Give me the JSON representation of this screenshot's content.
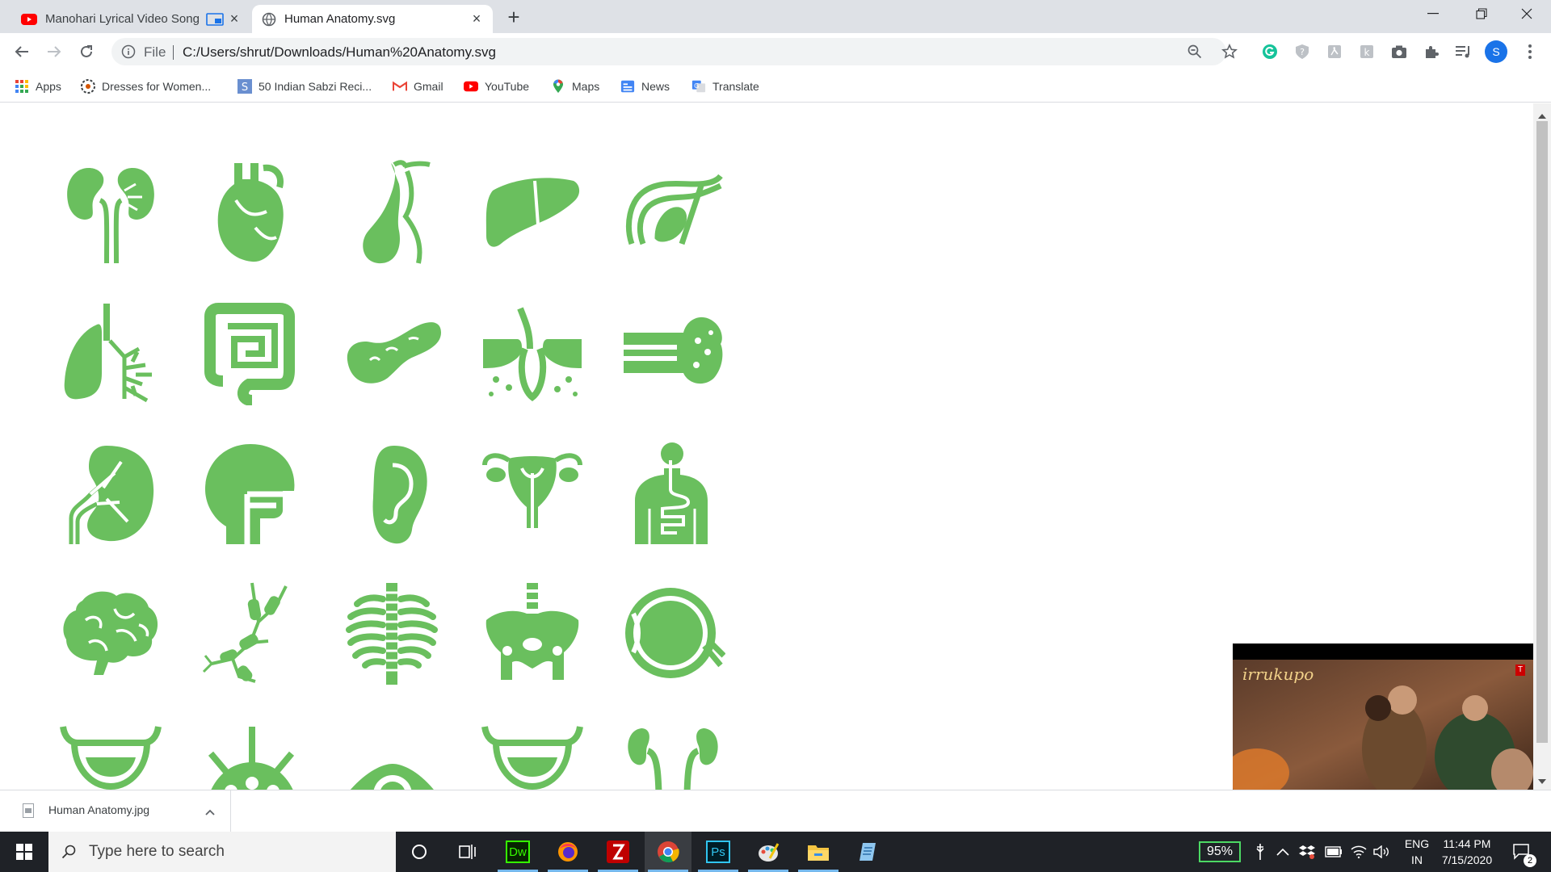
{
  "tabs": [
    {
      "title": "Manohari Lyrical Video Song",
      "icon": "youtube-icon",
      "extra_icon": "picture-in-picture-icon",
      "active": false
    },
    {
      "title": "Human Anatomy.svg",
      "icon": "globe-icon",
      "active": true
    }
  ],
  "new_tab_glyph": "+",
  "toolbar": {
    "scheme_label": "File",
    "url": "C:/Users/shrut/Downloads/Human%20Anatomy.svg",
    "profile_initial": "S"
  },
  "bookmarks": [
    {
      "label": "Apps",
      "icon": "apps-grid-icon"
    },
    {
      "label": "Dresses for Women...",
      "icon": "flower-icon"
    },
    {
      "label": "50 Indian Sabzi Reci...",
      "icon": "s-letter-icon"
    },
    {
      "label": "Gmail",
      "icon": "gmail-icon"
    },
    {
      "label": "YouTube",
      "icon": "youtube-icon"
    },
    {
      "label": "Maps",
      "icon": "maps-pin-icon"
    },
    {
      "label": "News",
      "icon": "news-icon"
    },
    {
      "label": "Translate",
      "icon": "translate-icon"
    }
  ],
  "organs": [
    "kidneys",
    "heart",
    "gallbladder",
    "liver",
    "stomach",
    "lungs",
    "intestines",
    "pancreas",
    "hair-follicle",
    "bone",
    "kidney-section",
    "head-throat",
    "ear",
    "uterus",
    "digestive-system",
    "brain",
    "neurons",
    "ribcage",
    "pelvis",
    "eye-section",
    "bladder",
    "virus",
    "eye",
    "bladder-2",
    "kidneys-2"
  ],
  "organ_color": "#6abf5e",
  "download": {
    "filename": "Human Anatomy.jpg",
    "icon": "image-file-icon"
  },
  "miniplayer": {
    "overlay_text": "irrukupo",
    "badge": "T"
  },
  "taskbar": {
    "search_placeholder": "Type here to search",
    "apps": [
      "cortana-icon",
      "task-view-icon",
      "dreamweaver-icon",
      "firefox-icon",
      "filezilla-icon",
      "chrome-icon",
      "photoshop-icon",
      "paint-icon",
      "file-explorer-icon",
      "notepad-icon"
    ],
    "dw_label": "Dw",
    "ps_label": "Ps",
    "battery_percent": "95%",
    "lang_top": "ENG",
    "lang_bottom": "IN",
    "time": "11:44 PM",
    "date": "7/15/2020",
    "notification_count": "2"
  }
}
